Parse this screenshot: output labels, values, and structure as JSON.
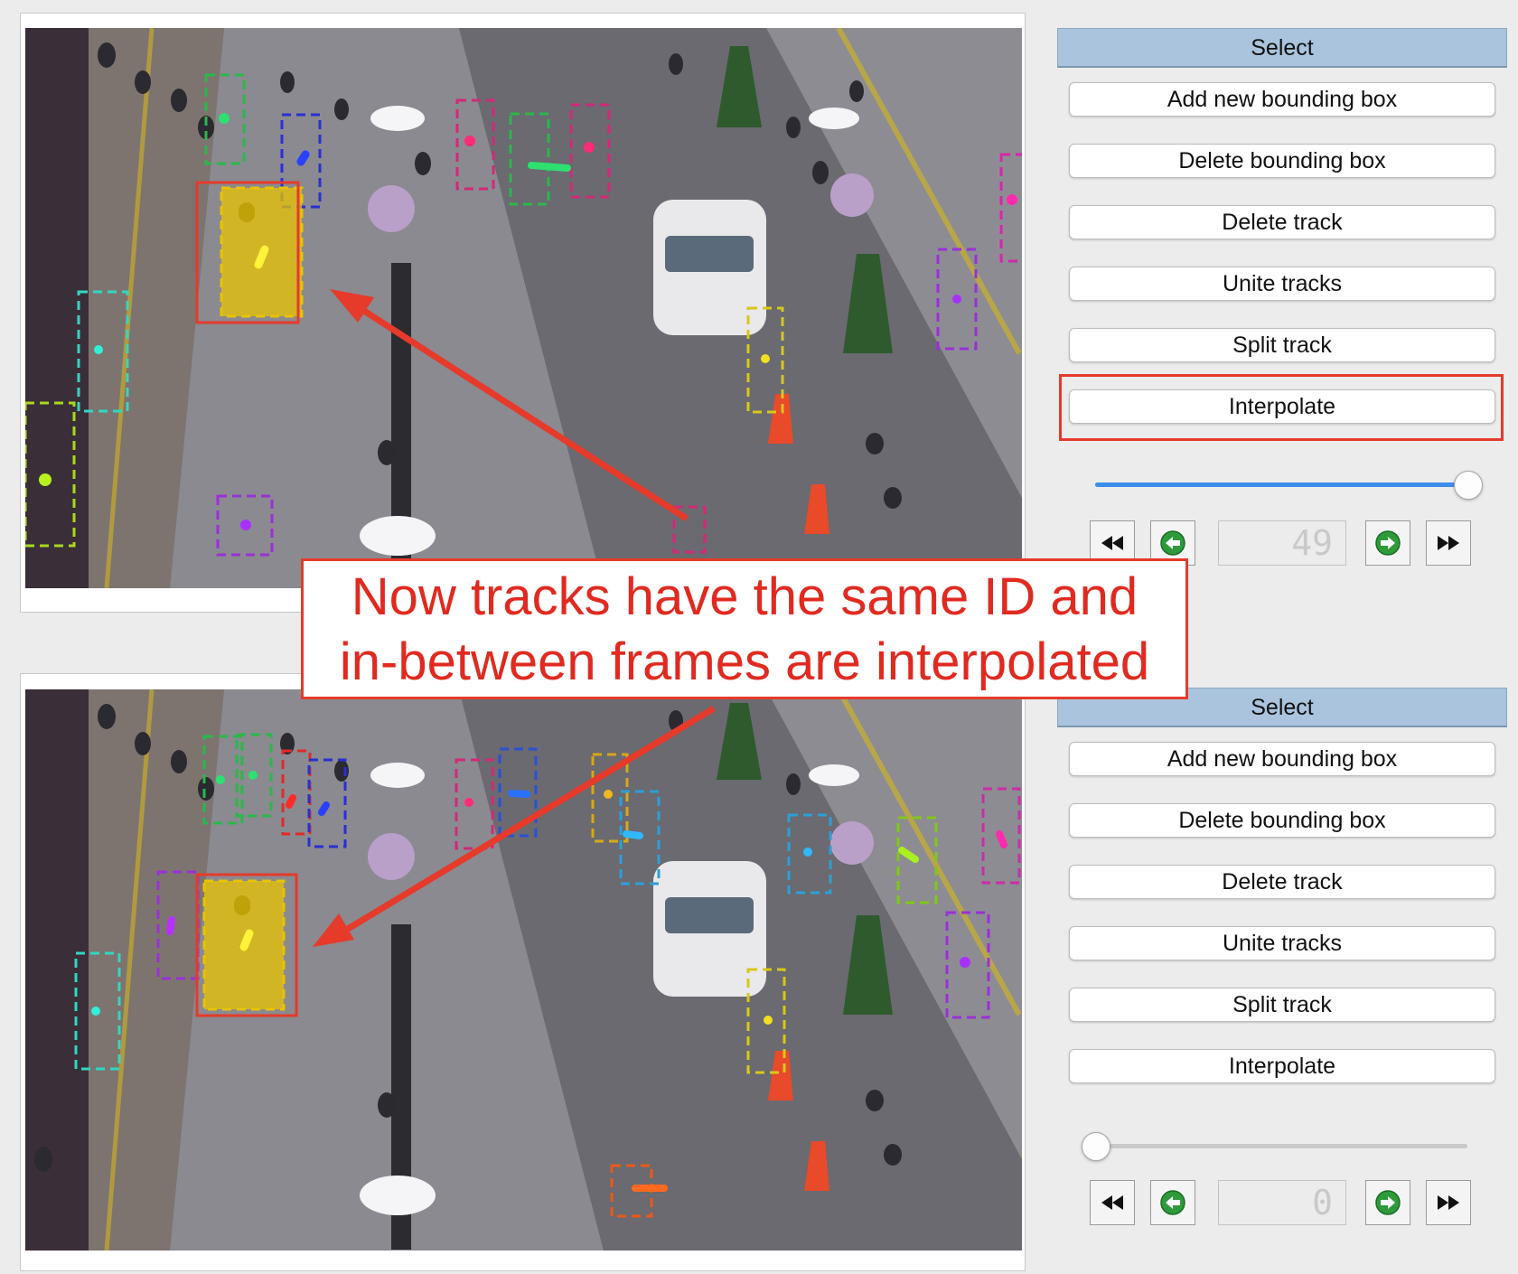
{
  "panels": [
    {
      "select_label": "Select",
      "buttons": [
        "Add new bounding box",
        "Delete bounding box",
        "Delete track",
        "Unite tracks",
        "Split track",
        "Interpolate"
      ],
      "slider_fraction": 1.0,
      "frame_display": "49",
      "highlighted_button": "Interpolate"
    },
    {
      "select_label": "Select",
      "buttons": [
        "Add new bounding box",
        "Delete bounding box",
        "Delete track",
        "Unite tracks",
        "Split track",
        "Interpolate"
      ],
      "slider_fraction": 0.0,
      "frame_display": "0"
    }
  ],
  "nav_icons": [
    "rewind-icon",
    "previous-frame-icon",
    "next-frame-icon",
    "fast-forward-icon"
  ],
  "annotation": {
    "line1": "Now tracks have the same ID and",
    "line2": "in-between frames are interpolated",
    "color": "#e63a2a"
  },
  "colors": {
    "select_header": "#a9c4dc",
    "slider_active": "#3d8ee8",
    "selected_track_fill": "#e8c300",
    "nav_green": "#2e9a3a"
  }
}
